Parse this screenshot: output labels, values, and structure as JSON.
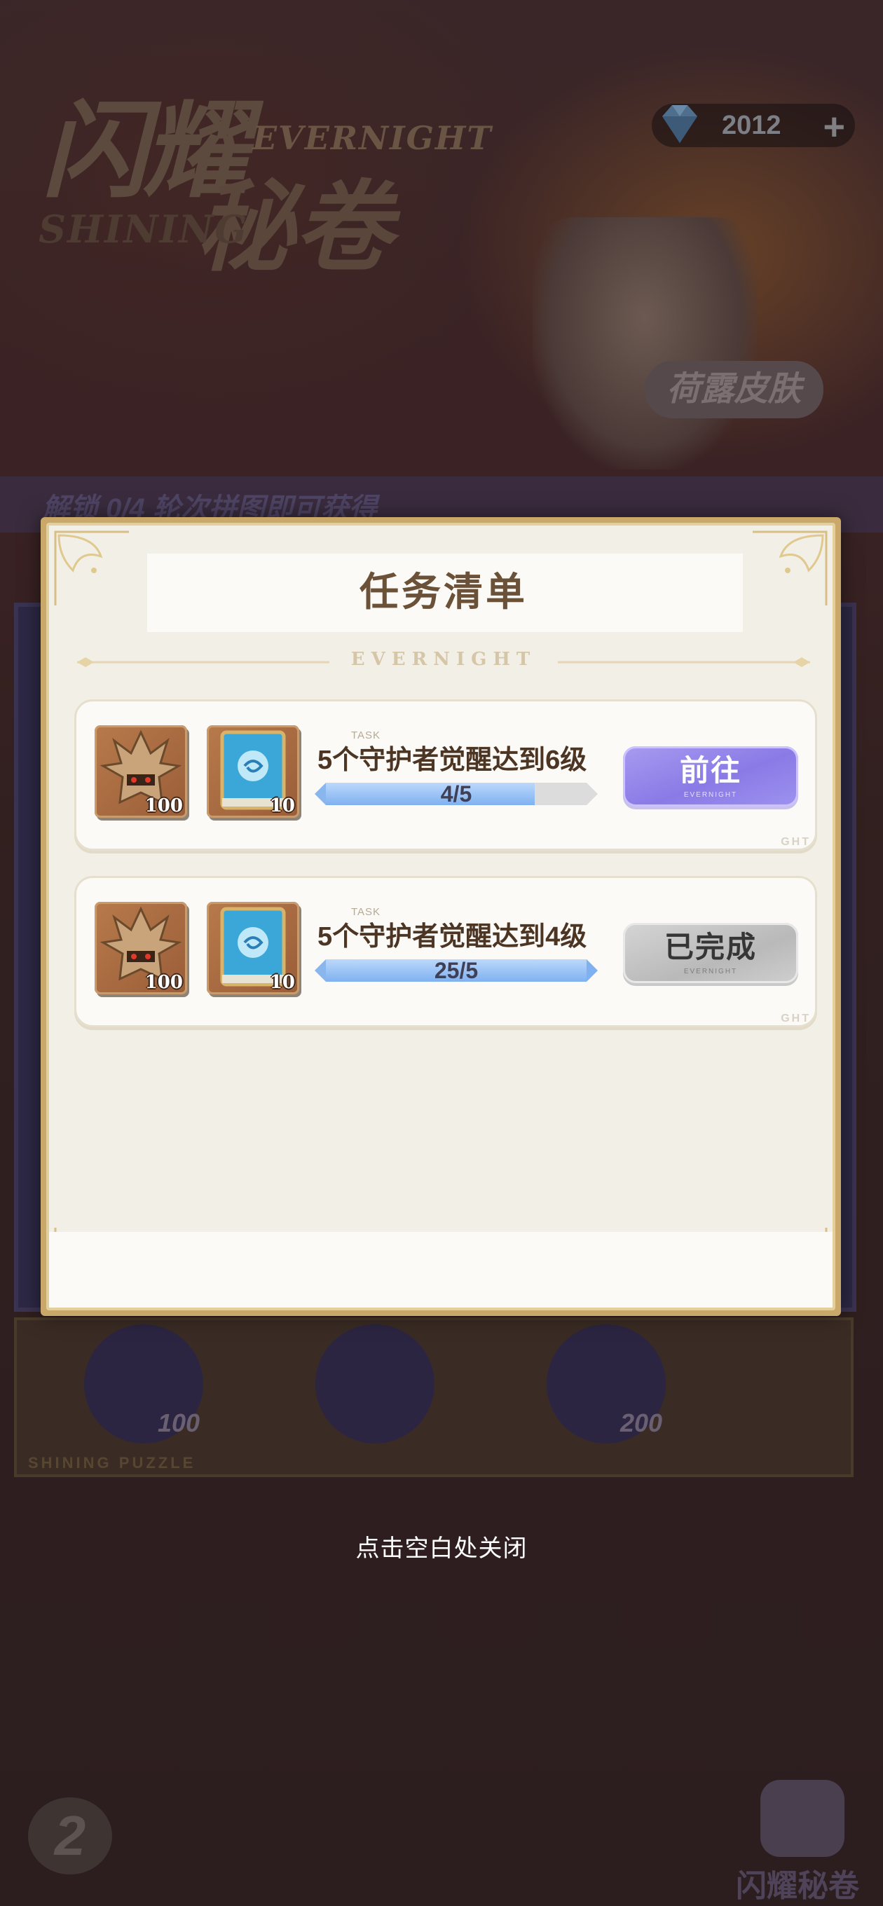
{
  "background": {
    "title_main": "闪耀",
    "title_sub": "秘卷",
    "title_en_1": "EVERNIGHT",
    "title_en_2": "SHINING",
    "currency_amount": "2012",
    "currency_plus": "+",
    "skin_tag": "荷露皮肤",
    "band_text": "解锁 0/4 轮次拼图即可获得",
    "reward_values": [
      "100",
      "200"
    ],
    "footer_label": "SHINING PUZZLE",
    "corner_logo": "2",
    "corner_label": "闪耀秘卷"
  },
  "modal": {
    "title": "任务清单",
    "subtitle": "EVERNIGHT",
    "tasks": [
      {
        "tag": "TASK",
        "name": "5个守护者觉醒达到6级",
        "progress_text": "4/5",
        "progress_fraction": 0.8,
        "rewards": [
          {
            "icon": "guardian-helmet-icon",
            "count": "100"
          },
          {
            "icon": "blue-spell-book-icon",
            "count": "10"
          }
        ],
        "button_label": "前往",
        "button_sub": "EVERNIGHT",
        "watermark": "GHT",
        "status": "go"
      },
      {
        "tag": "TASK",
        "name": "5个守护者觉醒达到4级",
        "progress_text": "25/5",
        "progress_fraction": 1.0,
        "rewards": [
          {
            "icon": "guardian-helmet-icon",
            "count": "100"
          },
          {
            "icon": "blue-spell-book-icon",
            "count": "10"
          }
        ],
        "button_label": "已完成",
        "button_sub": "EVERNIGHT",
        "watermark": "GHT",
        "status": "done"
      }
    ]
  },
  "close_hint": "点击空白处关闭",
  "colors": {
    "modal_frame": "#c9a869",
    "go_button": "#8a7ae6",
    "done_button": "#b9b9b9",
    "progress_fill": "#7fb1f0"
  }
}
